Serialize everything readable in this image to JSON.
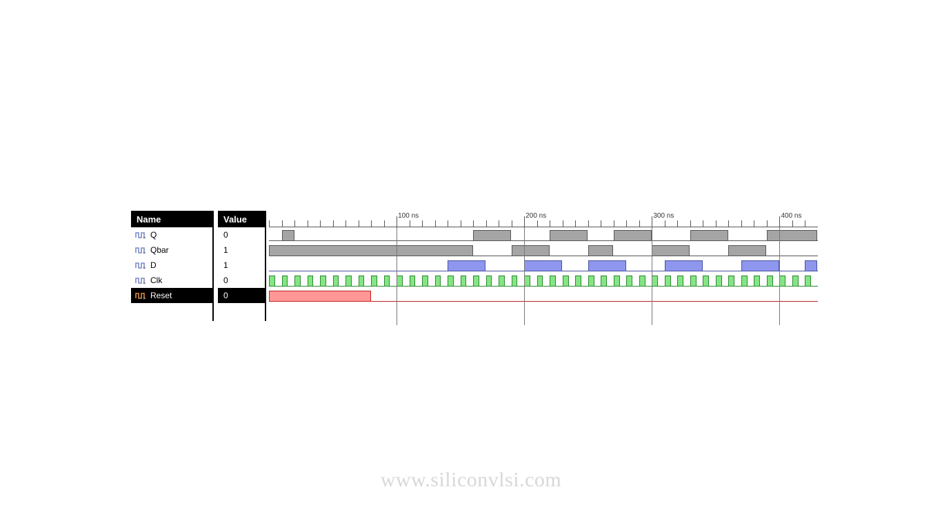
{
  "headers": {
    "name": "Name",
    "value": "Value"
  },
  "signals": [
    {
      "name": "Q",
      "value": "0",
      "selected": false,
      "color": "grey",
      "transitions": [
        0,
        1,
        0,
        0,
        0,
        0,
        0,
        0,
        0,
        0,
        0,
        0,
        0,
        0,
        0,
        0,
        1,
        1,
        1,
        0,
        0,
        0,
        1,
        1,
        1,
        0,
        0,
        1,
        1,
        1,
        0,
        0,
        0,
        1,
        1,
        1,
        0,
        0,
        0,
        1,
        1,
        1,
        1
      ],
      "period_ns": 10
    },
    {
      "name": "Qbar",
      "value": "1",
      "selected": false,
      "color": "grey",
      "transitions": [
        1,
        1,
        1,
        1,
        1,
        1,
        1,
        1,
        1,
        1,
        1,
        1,
        1,
        1,
        1,
        1,
        0,
        0,
        0,
        1,
        1,
        1,
        0,
        0,
        0,
        1,
        1,
        0,
        0,
        0,
        1,
        1,
        1,
        0,
        0,
        0,
        1,
        1,
        1,
        0,
        0,
        0,
        0
      ],
      "period_ns": 10
    },
    {
      "name": "D",
      "value": "1",
      "selected": false,
      "color": "blue",
      "transitions": [
        0,
        0,
        0,
        0,
        0,
        0,
        0,
        0,
        0,
        0,
        0,
        0,
        0,
        0,
        1,
        1,
        1,
        0,
        0,
        0,
        1,
        1,
        1,
        0,
        0,
        1,
        1,
        1,
        0,
        0,
        0,
        1,
        1,
        1,
        0,
        0,
        0,
        1,
        1,
        1,
        0,
        0,
        1
      ],
      "period_ns": 10
    },
    {
      "name": "Clk",
      "value": "0",
      "selected": false,
      "color": "green",
      "clock": true,
      "period_ns": 10,
      "cycles": 43
    },
    {
      "name": "Reset",
      "value": "0",
      "selected": true,
      "color": "red",
      "transitions": [
        1,
        1,
        1,
        1,
        1,
        1,
        1,
        1,
        0,
        0,
        0,
        0,
        0,
        0,
        0,
        0,
        0,
        0,
        0,
        0,
        0,
        0,
        0,
        0,
        0,
        0,
        0,
        0,
        0,
        0,
        0,
        0,
        0,
        0,
        0,
        0,
        0,
        0,
        0,
        0,
        0,
        0,
        0
      ],
      "period_ns": 10
    }
  ],
  "timescale": {
    "visible_start_ns": 0,
    "visible_end_ns": 430,
    "major_tick_ns": 100,
    "minor_tick_ns": 10,
    "labels": [
      "100 ns",
      "200 ns",
      "300 ns",
      "400 ns"
    ],
    "label_positions_ns": [
      100,
      200,
      300,
      400
    ]
  },
  "watermark": "www.siliconvlsi.com",
  "colors": {
    "grey": "#a0a0a0",
    "blue": "#828ceb",
    "green": "#78e178",
    "red": "#ff8c8c"
  }
}
